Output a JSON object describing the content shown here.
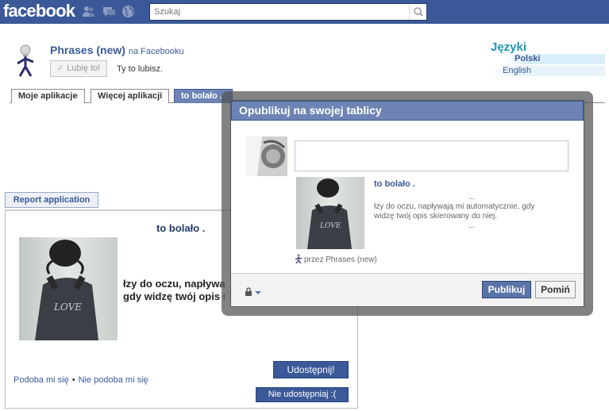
{
  "topbar": {
    "logo": "facebook",
    "search_placeholder": "Szukaj"
  },
  "app": {
    "title": "Phrases (new)",
    "title_suffix": "na Facebooku",
    "like_label": "Lubię to!",
    "like_text": "Ty to lubisz."
  },
  "languages": {
    "heading": "Języki",
    "items": [
      "Polski",
      "English"
    ]
  },
  "tabs": [
    "Moje aplikacje",
    "Więcej aplikacji",
    "to bolało ."
  ],
  "canvas": {
    "report_label": "Report application",
    "title": "to bolało .",
    "text_line1": "łzy do oczu, napływają mi automatycznie,",
    "text_line2": "gdy widzę twój opis skierowany do niej.",
    "like_link": "Podoba mi się",
    "dislike_link": "Nie podoba mi się",
    "share_label": "Udostępnij!",
    "noshare_label": "Nie udostępniaj :("
  },
  "dialog": {
    "header": "Opublikuj na swojej tablicy",
    "post_title": "to bolało .",
    "dots_top": "...",
    "body_line1": "łzy do oczu, napływają mi automatycznie, gdy",
    "body_line2": "widzę twój opis skierowany do niej.",
    "dots_bottom": "...",
    "via": "przez Phrases (new)",
    "publish_label": "Publikuj",
    "skip_label": "Pomiń"
  },
  "colors": {
    "brand": "#3b5998",
    "tab_active": "#6d84b4",
    "lang_heading": "#1e95b5"
  },
  "icons": [
    "friends-icon",
    "messages-icon",
    "globe-icon",
    "search-icon",
    "lock-icon",
    "chevron-down-icon",
    "check-icon",
    "app-figure-icon"
  ]
}
